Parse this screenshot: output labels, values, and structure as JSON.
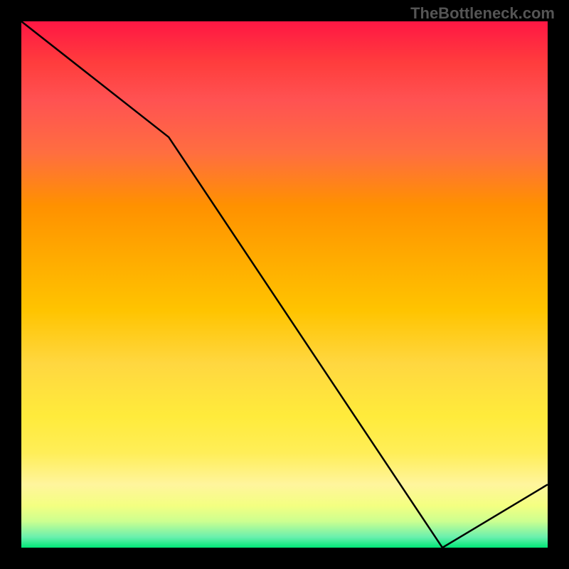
{
  "watermark": "TheBottleneck.com",
  "chart_data": {
    "type": "line",
    "x": [
      0,
      0.28,
      0.8,
      1.0
    ],
    "values": [
      1.0,
      0.78,
      0.0,
      0.12
    ],
    "annotation": {
      "x": 0.8,
      "y": 0.0,
      "text": ""
    },
    "title": "",
    "xlabel": "",
    "ylabel": "",
    "xlim": [
      0,
      1
    ],
    "ylim": [
      0,
      1
    ],
    "background": "heat-gradient"
  },
  "colors": {
    "line": "#000000",
    "background_frame": "#000000",
    "label": "#d32f2f"
  }
}
